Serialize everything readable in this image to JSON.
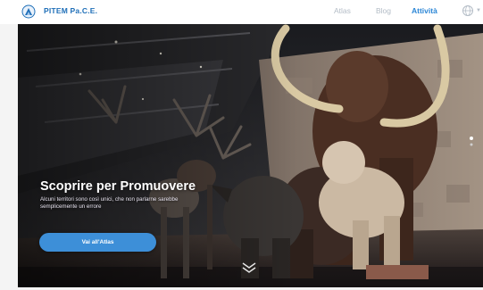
{
  "header": {
    "brand": "PITEM Pa.C.E.",
    "nav": [
      "Atlas",
      "Blog",
      "Attività"
    ],
    "active_nav": "Attività",
    "icons": [
      "logo-icon",
      "globe-icon"
    ]
  },
  "hero": {
    "title": "Scoprire per Promuovere",
    "subtitle": "Alcuni territori sono così unici, che non ​parlarne sarebbe semplicemente un errore",
    "cta_label": "Vai all'Atlas"
  },
  "colors": {
    "brand": "#1f6fb8",
    "active": "#2b86d6",
    "button": "#3d8fd8",
    "nav_inactive": "#b3bcc6"
  }
}
